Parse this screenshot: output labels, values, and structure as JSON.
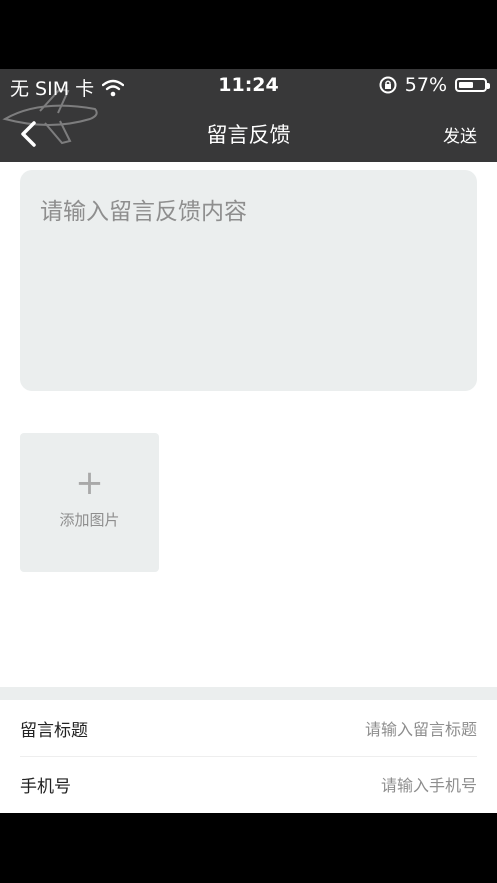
{
  "status_bar": {
    "carrier": "无 SIM 卡",
    "time": "11:24",
    "battery_percent": "57%",
    "battery_level": 0.57
  },
  "nav": {
    "title": "留言反馈",
    "send_label": "发送"
  },
  "feedback": {
    "placeholder": "请输入留言反馈内容"
  },
  "add_photo": {
    "label": "添加图片"
  },
  "form": {
    "title_label": "留言标题",
    "title_placeholder": "请输入留言标题",
    "phone_label": "手机号",
    "phone_placeholder": "请输入手机号"
  },
  "colors": {
    "header_bg": "#383839",
    "field_bg": "#ebeeee",
    "placeholder": "#8e8e8e"
  }
}
